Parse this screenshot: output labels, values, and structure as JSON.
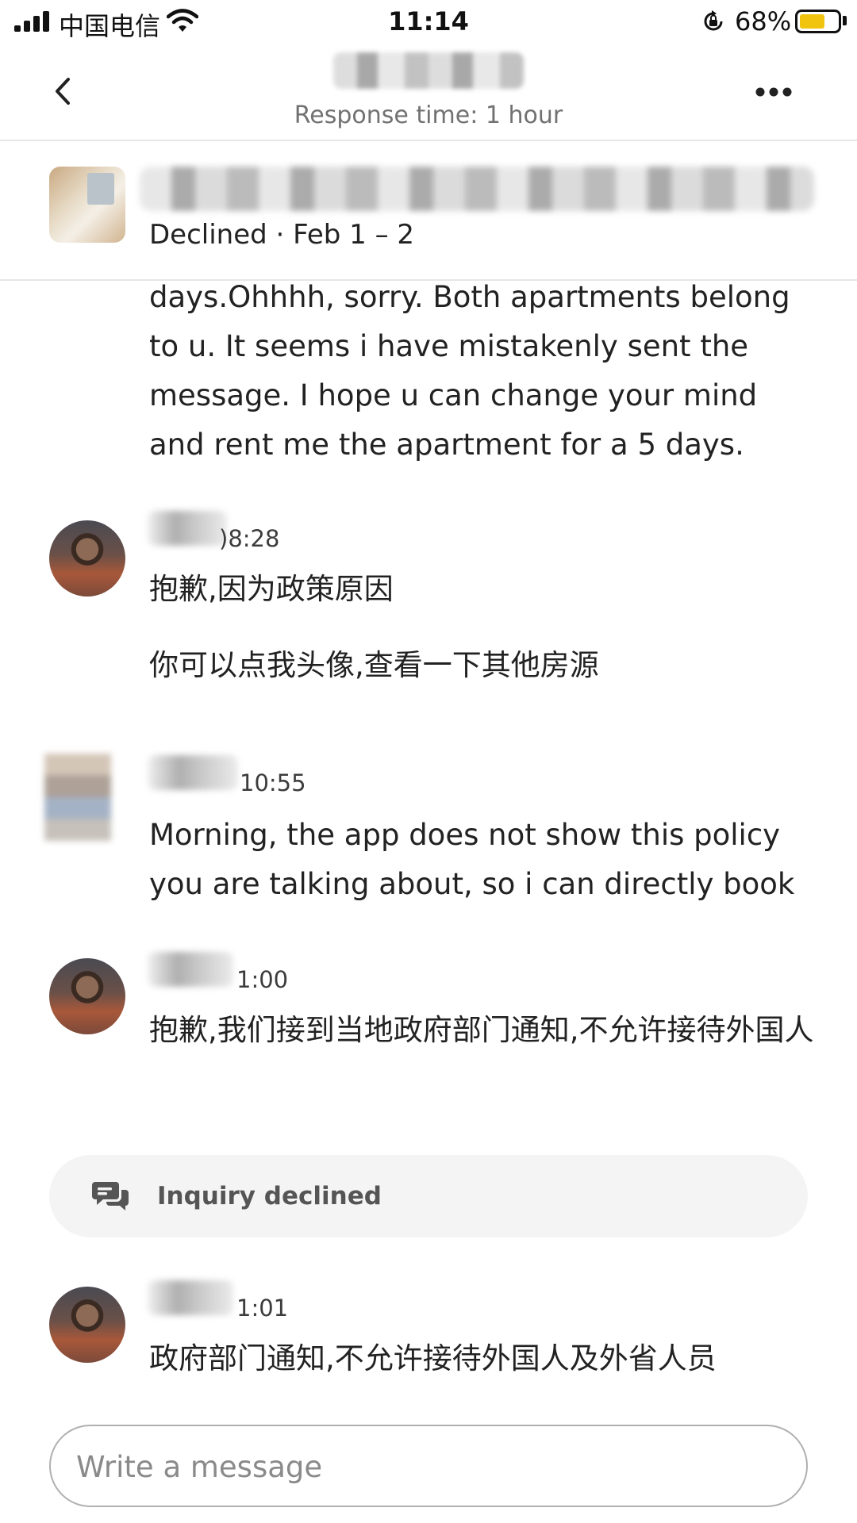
{
  "status_bar": {
    "carrier": "中国电信",
    "time": "11:14",
    "battery_percent": "68%",
    "battery_level": 0.68,
    "battery_color": "#f1c40f",
    "icons": [
      "signal-icon",
      "wifi-icon",
      "orientation-lock-icon",
      "battery-icon"
    ]
  },
  "header": {
    "response_time": "Response time: 1 hour",
    "icons": [
      "back-chevron-icon",
      "more-dots-icon"
    ]
  },
  "listing": {
    "status": "Declined · Feb 1 – 2"
  },
  "messages": [
    {
      "sender": "guest",
      "text": "days.Ohhhh, sorry. Both apartments belong to u. It seems i have mistakenly sent the message. I hope u can change your mind and rent me the apartment for a 5 days."
    },
    {
      "sender": "host",
      "time": "08:28",
      "time_visible": ")8:28",
      "lines": [
        "抱歉,因为政策原因",
        "你可以点我头像,查看一下其他房源"
      ]
    },
    {
      "sender": "guest",
      "time": "10:55",
      "text": "Morning, the app does not show this policy you are talking about, so i can directly book"
    },
    {
      "sender": "host",
      "time_visible": "1:00",
      "text": "抱歉,我们接到当地政府部门通知,不允许接待外国人"
    },
    {
      "sender": "host",
      "time_visible": "1:01",
      "text": "政府部门通知,不允许接待外国人及外省人员"
    }
  ],
  "event": {
    "label": "Inquiry declined",
    "icon": "chat-bubbles-icon"
  },
  "composer": {
    "placeholder": "Write a message"
  }
}
